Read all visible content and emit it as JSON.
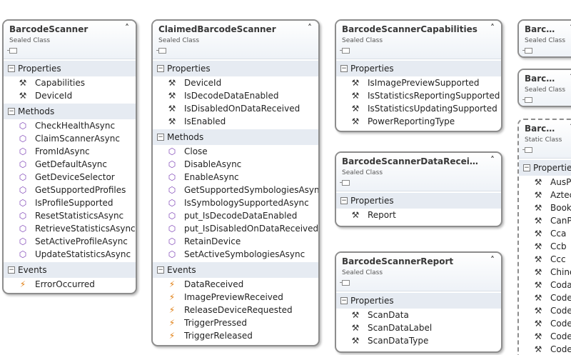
{
  "diagram": {
    "classes": [
      {
        "id": "BarcodeScanner",
        "title": "BarcodeScanner",
        "kind": "Sealed Class",
        "sections": [
          {
            "name": "Properties",
            "kind": "property",
            "items": [
              "Capabilities",
              "DeviceId"
            ]
          },
          {
            "name": "Methods",
            "kind": "method",
            "items": [
              "CheckHealthAsync",
              "ClaimScannerAsync",
              "FromIdAsync",
              "GetDefaultAsync",
              "GetDeviceSelector",
              "GetSupportedProfiles",
              "IsProfileSupported",
              "ResetStatisticsAsync",
              "RetrieveStatisticsAsync",
              "SetActiveProfileAsync",
              "UpdateStatisticsAsync"
            ]
          },
          {
            "name": "Events",
            "kind": "event",
            "items": [
              "ErrorOccurred"
            ]
          }
        ]
      },
      {
        "id": "ClaimedBarcodeScanner",
        "title": "ClaimedBarcodeScanner",
        "kind": "Sealed Class",
        "sections": [
          {
            "name": "Properties",
            "kind": "property",
            "items": [
              "DeviceId",
              "IsDecodeDataEnabled",
              "IsDisabledOnDataReceived",
              "IsEnabled"
            ]
          },
          {
            "name": "Methods",
            "kind": "method",
            "items": [
              "Close",
              "DisableAsync",
              "EnableAsync",
              "GetSupportedSymbologiesAsync",
              "IsSymbologySupportedAsync",
              "put_IsDecodeDataEnabled",
              "put_IsDisabledOnDataReceived",
              "RetainDevice",
              "SetActiveSymbologiesAsync"
            ]
          },
          {
            "name": "Events",
            "kind": "event",
            "items": [
              "DataReceived",
              "ImagePreviewReceived",
              "ReleaseDeviceRequested",
              "TriggerPressed",
              "TriggerReleased"
            ]
          }
        ]
      },
      {
        "id": "BarcodeScannerCapabilities",
        "title": "BarcodeScannerCapabilities",
        "kind": "Sealed Class",
        "sections": [
          {
            "name": "Properties",
            "kind": "property",
            "items": [
              "IsImagePreviewSupported",
              "IsStatisticsReportingSupported",
              "IsStatisticsUpdatingSupported",
              "PowerReportingType"
            ]
          }
        ]
      },
      {
        "id": "BarcodeScannerDataReceivedEventArgs",
        "title": "BarcodeScannerDataReceivedEv...",
        "kind": "Sealed Class",
        "sections": [
          {
            "name": "Properties",
            "kind": "property",
            "items": [
              "Report"
            ]
          }
        ]
      },
      {
        "id": "BarcodeScannerReport",
        "title": "BarcodeScannerReport",
        "kind": "Sealed Class",
        "sections": [
          {
            "name": "Properties",
            "kind": "property",
            "items": [
              "ScanData",
              "ScanDataLabel",
              "ScanDataType"
            ]
          }
        ]
      },
      {
        "id": "BarcodeScannerPartial1",
        "title": "BarcodeSca",
        "kind": "Sealed Class",
        "sections": []
      },
      {
        "id": "BarcodeScannerPartial2",
        "title": "BarcodeSca",
        "kind": "Sealed Class",
        "sections": []
      },
      {
        "id": "BarcodeSymbologies",
        "title": "BarcodeSym",
        "kind": "Static Class",
        "sections": [
          {
            "name": "Properties",
            "kind": "property",
            "items": [
              "AusPo",
              "Aztec",
              "Bookl",
              "CanPo",
              "Cca",
              "Ccb",
              "Ccc",
              "Chine",
              "Codal",
              "Code",
              "Code",
              "Code",
              "Code",
              "Code"
            ]
          }
        ]
      }
    ]
  }
}
